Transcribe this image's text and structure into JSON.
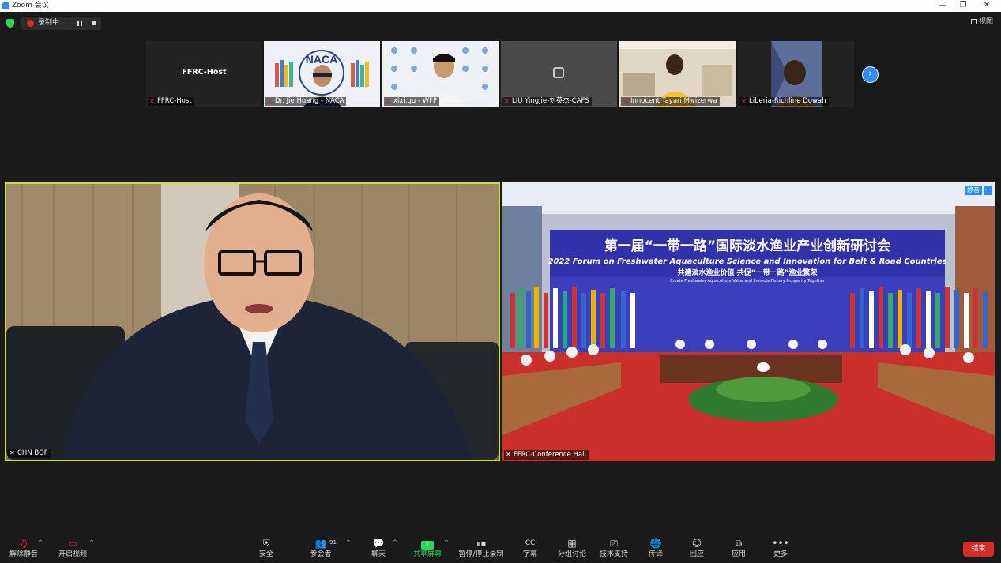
{
  "window": {
    "title": "Zoom 会议",
    "min": "—",
    "max": "❐",
    "close": "✕"
  },
  "status": {
    "recording_label": "录制中...",
    "view_label": "视图"
  },
  "thumbnails": [
    {
      "name": "FFRC-Host"
    },
    {
      "name": "Dr. Jie Huang - NACA",
      "logo": "NACA"
    },
    {
      "name": "xixi.qu - WFP"
    },
    {
      "name": "LIU Yingjie-刘英杰-CAFS"
    },
    {
      "name": "Innocent Tayari Mwizerwa"
    },
    {
      "name": "Liberia-Richline Dowah"
    }
  ],
  "main": {
    "speaker_name": "CHN BOF",
    "hall_name": "FFRC-Conference Hall",
    "hall_tag": "静音",
    "hall_more": "···",
    "banner": {
      "title_cn": "第一届“一带一路”国际淡水渔业产业创新研讨会",
      "title_en": "2022 Forum on Freshwater Aquaculture Science and Innovation for Belt & Road Countries",
      "sub_cn": "共建淡水渔业价值 共促“一带一路”渔业繁荣",
      "sub_en": "Create Freshwater Aquaculture Value and Promote Fishery Prosperity Together"
    }
  },
  "toolbar": {
    "unmute": "解除静音",
    "start_video": "开启视频",
    "security": "安全",
    "participants": "参会者",
    "participants_count": "91",
    "chat": "聊天",
    "share": "共享屏幕",
    "pause_record": "暂停/停止录制",
    "captions": "字幕",
    "breakout": "分组讨论",
    "support": "技术支持",
    "interpret": "传译",
    "reactions": "回应",
    "apps": "应用",
    "more": "更多",
    "end": "结束"
  },
  "colors": {
    "accent": "#2d8cff",
    "active_border": "#c9e02d",
    "end": "#d92a2a",
    "share": "#23d959"
  }
}
